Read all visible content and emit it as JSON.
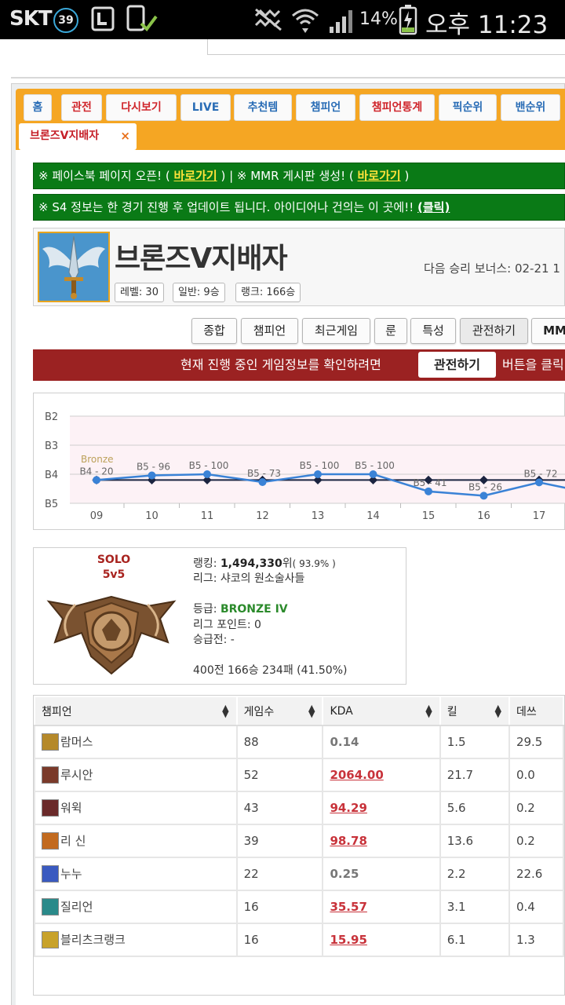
{
  "statusbar": {
    "carrier": "SKT",
    "badge": "39",
    "battery_pct": "14%",
    "time": "오후 11:23"
  },
  "tabs": [
    {
      "label": "홈",
      "color": "blue"
    },
    {
      "label": "관전",
      "color": "red"
    },
    {
      "label": "다시보기",
      "color": "red"
    },
    {
      "label": "LIVE",
      "color": "blue"
    },
    {
      "label": "추천템",
      "color": "blue"
    },
    {
      "label": "챔피언",
      "color": "blue"
    },
    {
      "label": "챔피언통계",
      "color": "red"
    },
    {
      "label": "픽순위",
      "color": "blue"
    },
    {
      "label": "밴순위",
      "color": "blue"
    }
  ],
  "active_tab": {
    "label": "브론즈V지배자",
    "close": "×"
  },
  "notices": [
    {
      "pre": "※ 페이스북 페이지 오픈! ( ",
      "link1": "바로가기",
      "mid": " ) | ※ MMR 게시판 생성! ( ",
      "link2": "바로가기",
      "post": " )"
    },
    {
      "pre": "※ S4 정보는 한 경기 진행 후 업데이트 됩니다. 아이디어나 건의는 이 곳에!! ",
      "link1": "(클릭)"
    }
  ],
  "profile": {
    "name": "브론즈V지배자",
    "bonus": "다음 승리 보너스: 02-21 1",
    "level": "레벨: 30",
    "normal": "일반: 9승",
    "ranked": "랭크: 166승"
  },
  "sections": [
    "종합",
    "챔피언",
    "최근게임",
    "룬",
    "특성",
    "관전하기",
    "MM"
  ],
  "spectate_bar": {
    "text1": "현재 진행 중인 게임정보를 확인하려면",
    "button": "관전하기",
    "text2": "버튼을 클릭"
  },
  "chart_data": {
    "type": "line",
    "y_tick_labels": [
      "B2",
      "B3",
      "B4",
      "B5"
    ],
    "x": [
      "09",
      "10",
      "11",
      "12",
      "13",
      "14",
      "15",
      "16",
      "17"
    ],
    "series": [
      {
        "values": [
          4.2,
          4.04,
          4.0,
          4.27,
          4.0,
          4.0,
          4.59,
          4.74,
          4.28
        ],
        "labels": [
          "B4 - 20",
          "B5 - 96",
          "B5 - 100",
          "B5 - 73",
          "B5 - 100",
          "B5 - 100",
          "B5 - 41",
          "B5 - 26",
          "B5 - 72"
        ],
        "color": "#3a82d6"
      },
      {
        "values": [
          4.2,
          4.2,
          4.2,
          4.2,
          4.2,
          4.2,
          4.2,
          4.2,
          4.2
        ],
        "color": "#1b2440"
      }
    ],
    "tier_band_label": "Bronze",
    "ylim": [
      2,
      5
    ],
    "grid": true
  },
  "rank": {
    "queue1": "SOLO",
    "queue2": "5v5",
    "ranking_label": "랭킹: ",
    "ranking_value": "1,494,330",
    "ranking_suffix": "위",
    "ranking_pct": "( 93.9% )",
    "league": "리그: 샤코의 원소술사들",
    "tier_label": "등급: ",
    "tier_value": "BRONZE IV",
    "points": "리그 포인트: 0",
    "promo": "승급전: -",
    "record": "400전 166승 234패 (41.50%)"
  },
  "table": {
    "headers": [
      "챔피언",
      "게임수",
      "KDA",
      "킬",
      "데쓰"
    ],
    "rows": [
      {
        "champ": "람머스",
        "games": "88",
        "kda": "0.14",
        "kda_style": "gray",
        "kills": "1.5",
        "deaths": "29.5",
        "icon": "#b5892a"
      },
      {
        "champ": "루시안",
        "games": "52",
        "kda": "2064.00",
        "kda_style": "red",
        "kills": "21.7",
        "deaths": "0.0",
        "icon": "#7a3a2a"
      },
      {
        "champ": "워윅",
        "games": "43",
        "kda": "94.29",
        "kda_style": "red",
        "kills": "5.6",
        "deaths": "0.2",
        "icon": "#6a2a2a"
      },
      {
        "champ": "리 신",
        "games": "39",
        "kda": "98.78",
        "kda_style": "red",
        "kills": "13.6",
        "deaths": "0.2",
        "icon": "#c26a1f"
      },
      {
        "champ": "누누",
        "games": "22",
        "kda": "0.25",
        "kda_style": "gray",
        "kills": "2.2",
        "deaths": "22.6",
        "icon": "#3a5ac0"
      },
      {
        "champ": "질리언",
        "games": "16",
        "kda": "35.57",
        "kda_style": "red",
        "kills": "3.1",
        "deaths": "0.4",
        "icon": "#2a8a8a"
      },
      {
        "champ": "블리츠크랭크",
        "games": "16",
        "kda": "15.95",
        "kda_style": "red",
        "kills": "6.1",
        "deaths": "1.3",
        "icon": "#c8a22a"
      }
    ]
  }
}
